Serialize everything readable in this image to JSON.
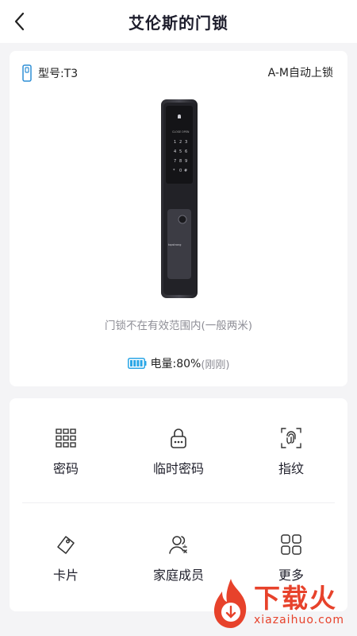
{
  "header": {
    "title": "艾伦斯的门锁"
  },
  "device": {
    "model_label": "型号:T3",
    "auto_lock": "A-M自动上锁",
    "range_status": "门锁不在有效范围内(一般两米)",
    "battery_label": "电量:80%",
    "battery_time": "(刚刚)",
    "battery_level": 0.8,
    "lock_brand": "topstrong"
  },
  "menu": {
    "items": [
      {
        "label": "密码",
        "icon": "keypad-icon"
      },
      {
        "label": "临时密码",
        "icon": "temp-lock-icon"
      },
      {
        "label": "指纹",
        "icon": "fingerprint-icon"
      },
      {
        "label": "卡片",
        "icon": "card-icon"
      },
      {
        "label": "家庭成员",
        "icon": "family-members-icon"
      },
      {
        "label": "更多",
        "icon": "more-grid-icon"
      }
    ]
  },
  "watermark": {
    "text": "下载火",
    "sub": "xiazaihuo.com"
  },
  "colors": {
    "accent": "#2f8fd6",
    "battery": "#2aa6e6",
    "watermark": "#e7422b"
  }
}
